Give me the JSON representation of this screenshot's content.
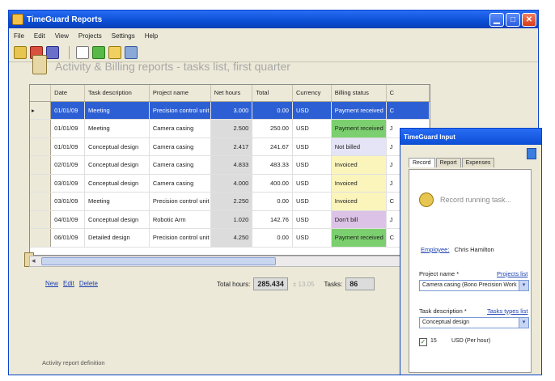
{
  "window": {
    "title": "TimeGuard Reports"
  },
  "menu": [
    "File",
    "Edit",
    "View",
    "Projects",
    "Settings",
    "Help"
  ],
  "report": {
    "title": "Activity & Billing reports  -  tasks list,  first quarter"
  },
  "grid": {
    "columns": [
      "Date",
      "Task description",
      "Project name",
      "Net hours",
      "Total",
      "Currency",
      "Billing status",
      "C"
    ],
    "rows": [
      {
        "date": "01/01/09",
        "task": "Meeting",
        "project": "Precision control unit",
        "hours": "3.000",
        "total": "0.00",
        "currency": "USD",
        "status": "Payment received",
        "extra": "C",
        "status_class": "st-paid",
        "selected": true
      },
      {
        "date": "01/01/09",
        "task": "Meeting",
        "project": "Camera casing",
        "hours": "2.500",
        "total": "250.00",
        "currency": "USD",
        "status": "Payment received",
        "extra": "J",
        "status_class": "st-paid"
      },
      {
        "date": "01/01/09",
        "task": "Conceptual design",
        "project": "Camera casing",
        "hours": "2.417",
        "total": "241.67",
        "currency": "USD",
        "status": "Not billed",
        "extra": "J",
        "status_class": "st-notbilled"
      },
      {
        "date": "02/01/09",
        "task": "Conceptual design",
        "project": "Camera casing",
        "hours": "4.833",
        "total": "483.33",
        "currency": "USD",
        "status": "Invoiced",
        "extra": "J",
        "status_class": "st-invoiced"
      },
      {
        "date": "03/01/09",
        "task": "Conceptual design",
        "project": "Camera casing",
        "hours": "4.000",
        "total": "400.00",
        "currency": "USD",
        "status": "Invoiced",
        "extra": "J",
        "status_class": "st-invoiced"
      },
      {
        "date": "03/01/09",
        "task": "Meeting",
        "project": "Precision control unit",
        "hours": "2.250",
        "total": "0.00",
        "currency": "USD",
        "status": "Invoiced",
        "extra": "C",
        "status_class": "st-invoiced"
      },
      {
        "date": "04/01/09",
        "task": "Conceptual design",
        "project": "Robotic Arm",
        "hours": "1.020",
        "total": "142.76",
        "currency": "USD",
        "status": "Don't bill",
        "extra": "J",
        "status_class": "st-dontbill"
      },
      {
        "date": "06/01/09",
        "task": "Detailed design",
        "project": "Precision control unit",
        "hours": "4.250",
        "total": "0.00",
        "currency": "USD",
        "status": "Payment received",
        "extra": "C",
        "status_class": "st-paid"
      }
    ]
  },
  "actions": {
    "new": "New",
    "edit": "Edit",
    "delete": "Delete"
  },
  "totals": {
    "hours_label": "Total hours:",
    "hours_value": "285.434",
    "faint": "± 13.05",
    "tasks_label": "Tasks:",
    "tasks_value": "86"
  },
  "footer": {
    "activity_def": "Activity report definition"
  },
  "panel": {
    "title": "TimeGuard Input",
    "tabs": [
      "Record",
      "Report",
      "Expenses"
    ],
    "record_text": "Record running task...",
    "employee_label": "Employee:",
    "employee_value": "Chris Hamilton",
    "project_label": "Project name *",
    "projects_link": "Projects list",
    "project_value": "Camera casing  (Bono Precision Work",
    "task_label": "Task description *",
    "task_link": "Tasks types list",
    "task_value": "Conceptual design",
    "rate_value": "15",
    "currency_value": "USD (Per hour)"
  }
}
